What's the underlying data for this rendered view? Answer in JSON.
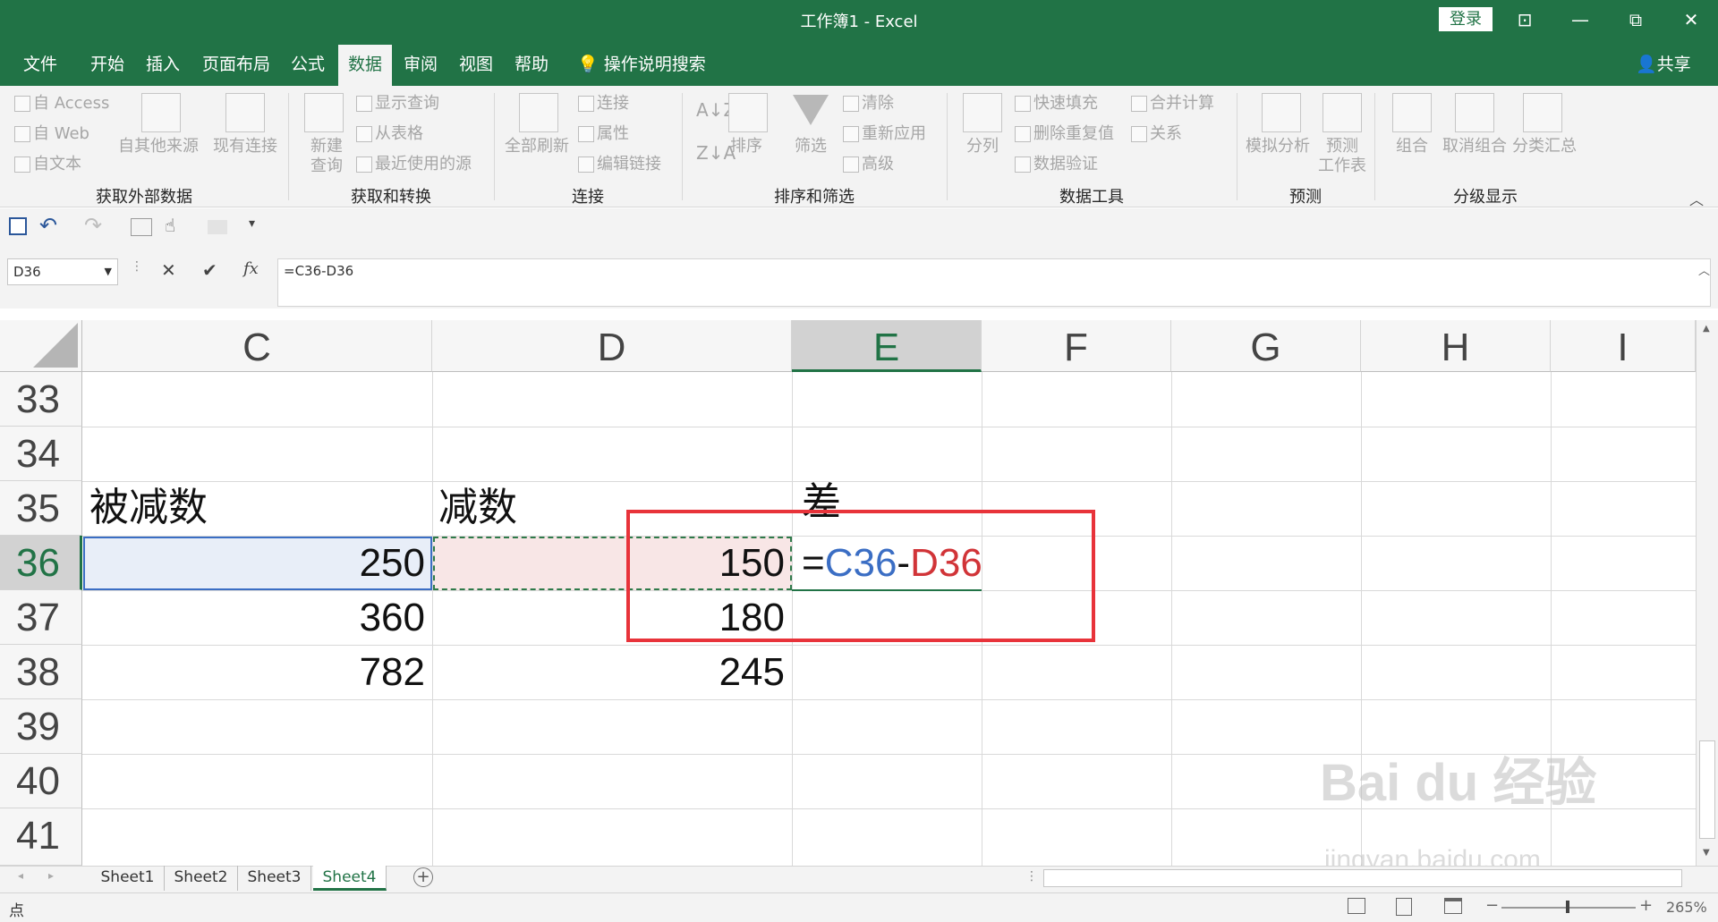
{
  "window": {
    "title": "工作簿1  -  Excel",
    "login": "登录",
    "minimize": "—",
    "restore": "⧉",
    "close": "✕",
    "ribbon_opts": "⊡"
  },
  "menu": {
    "tabs": [
      "文件",
      "开始",
      "插入",
      "页面布局",
      "公式",
      "数据",
      "审阅",
      "视图",
      "帮助"
    ],
    "active": "数据",
    "tell_me": "操作说明搜索",
    "share": "共享"
  },
  "ribbon": {
    "get_external": {
      "access": "自 Access",
      "web": "自 Web",
      "text": "自文本",
      "other": "自其他来源",
      "existing": "现有连接",
      "label": "获取外部数据"
    },
    "transform": {
      "new_query": "新建\n查询",
      "show_queries": "显示查询",
      "from_table": "从表格",
      "recent": "最近使用的源",
      "label": "获取和转换"
    },
    "connections": {
      "refresh_all": "全部刷新",
      "connections": "连接",
      "properties": "属性",
      "edit_links": "编辑链接",
      "label": "连接"
    },
    "sort_filter": {
      "sort": "排序",
      "filter": "筛选",
      "clear": "清除",
      "reapply": "重新应用",
      "advanced": "高级",
      "label": "排序和筛选"
    },
    "data_tools": {
      "split": "分列",
      "flash_fill": "快速填充",
      "remove_dup": "删除重复值",
      "validation": "数据验证",
      "consolidate": "合并计算",
      "relations": "关系",
      "label": "数据工具"
    },
    "forecast": {
      "what_if": "模拟分析",
      "sheet": "预测\n工作表",
      "label": "预测"
    },
    "outline": {
      "group": "组合",
      "ungroup": "取消组合",
      "subtotal": "分类汇总",
      "label": "分级显示"
    }
  },
  "formula_bar": {
    "name_box": "D36",
    "formula": "=C36-D36",
    "cancel": "✕",
    "enter": "✔",
    "fx": "fx"
  },
  "columns": [
    "C",
    "D",
    "E",
    "F",
    "G",
    "H",
    "I"
  ],
  "rows": [
    "33",
    "34",
    "35",
    "36",
    "37",
    "38",
    "39",
    "40",
    "41"
  ],
  "cells": {
    "c35": "被减数",
    "d35": "减数",
    "e35": "差",
    "c36": "250",
    "d36": "150",
    "c37": "360",
    "d37": "180",
    "c38": "782",
    "d38": "245",
    "e36_eq": "=",
    "e36_ref1": "C36",
    "e36_minus": "-",
    "e36_ref2": "D36"
  },
  "sheets": [
    "Sheet1",
    "Sheet2",
    "Sheet3",
    "Sheet4"
  ],
  "active_sheet": "Sheet4",
  "status": {
    "mode": "点",
    "zoom": "265%"
  },
  "watermark": {
    "main": "Bai du 经验",
    "url": "jingyan.baidu.com"
  },
  "colors": {
    "excel_green": "#217346",
    "ref_blue": "#3b6ec4",
    "ref_red": "#d13438",
    "highlight_box": "#e8333a"
  }
}
